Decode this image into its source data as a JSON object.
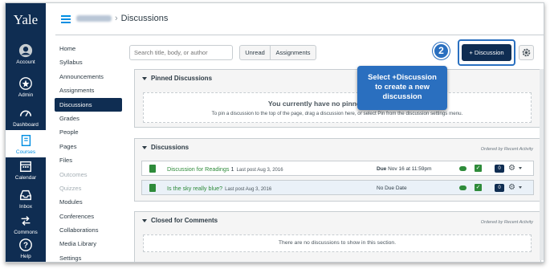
{
  "global_nav": {
    "logo": "Yale",
    "items": [
      {
        "label": "Account",
        "icon": "user-circle-icon"
      },
      {
        "label": "Admin",
        "icon": "admin-shield-icon"
      },
      {
        "label": "Dashboard",
        "icon": "dashboard-gauge-icon"
      },
      {
        "label": "Courses",
        "icon": "courses-book-icon",
        "active": true
      },
      {
        "label": "Calendar",
        "icon": "calendar-icon"
      },
      {
        "label": "Inbox",
        "icon": "inbox-tray-icon"
      },
      {
        "label": "Commons",
        "icon": "commons-arrows-icon"
      },
      {
        "label": "Help",
        "icon": "help-question-icon"
      }
    ]
  },
  "header": {
    "separator": "›",
    "page_title": "Discussions"
  },
  "course_nav": {
    "items": [
      {
        "label": "Home"
      },
      {
        "label": "Syllabus"
      },
      {
        "label": "Announcements"
      },
      {
        "label": "Assignments"
      },
      {
        "label": "Discussions",
        "active": true
      },
      {
        "label": "Grades"
      },
      {
        "label": "People"
      },
      {
        "label": "Pages"
      },
      {
        "label": "Files"
      },
      {
        "label": "Outcomes",
        "muted": true
      },
      {
        "label": "Quizzes",
        "muted": true
      },
      {
        "label": "Modules"
      },
      {
        "label": "Conferences"
      },
      {
        "label": "Collaborations"
      },
      {
        "label": "Media Library"
      },
      {
        "label": "Settings"
      }
    ]
  },
  "toolbar": {
    "search_placeholder": "Search title, body, or author",
    "unread_label": "Unread",
    "assignments_label": "Assignments",
    "add_discussion_label": "+ Discussion"
  },
  "annotation": {
    "step_number": "2",
    "callout_lines": [
      "Select +Discussion",
      "to create a new",
      "discussion"
    ]
  },
  "pinned": {
    "heading": "Pinned Discussions",
    "empty_title": "You currently have no pinned discussions",
    "empty_hint": "To pin a discussion to the top of the page, drag a discussion here, or select Pin from the discussion settings menu."
  },
  "discussions": {
    "heading": "Discussions",
    "ordered_note": "Ordered by Recent Activity",
    "rows": [
      {
        "title": "Discussion for Readings",
        "unread_count": "1",
        "last_post": "Last post Aug 3, 2016",
        "due_label": "Due",
        "due_value": "Nov 16 at 11:59pm",
        "replies": "0"
      },
      {
        "title": "Is the sky really blue?",
        "unread_count": "",
        "last_post": "Last post Aug 3, 2016",
        "due_label": "",
        "due_value": "No Due Date",
        "replies": "0"
      }
    ]
  },
  "closed": {
    "heading": "Closed for Comments",
    "ordered_note": "Ordered by Recent Activity",
    "empty_text": "There are no discussions to show in this section."
  },
  "colors": {
    "nav_dark": "#0f2d52",
    "link_green": "#2e8b3a",
    "annotation_blue": "#2a6fbf",
    "accent_blue": "#008ee2"
  }
}
